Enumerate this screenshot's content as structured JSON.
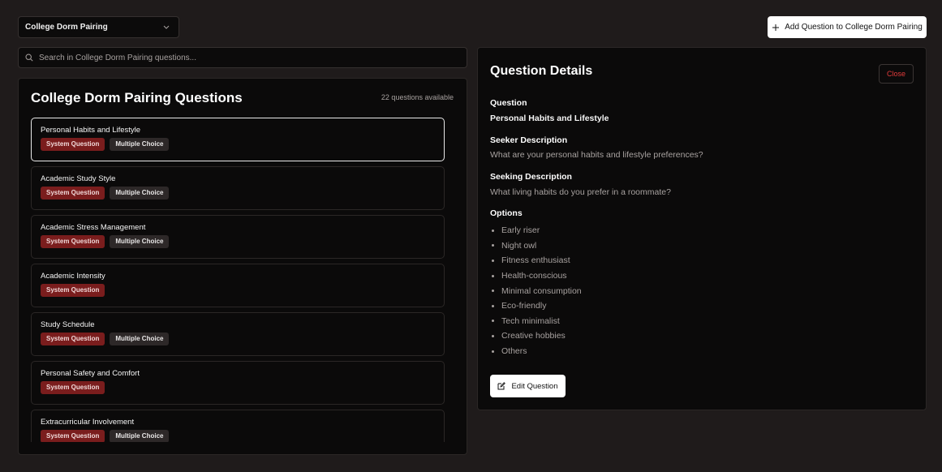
{
  "category_select": {
    "value": "College Dorm Pairing"
  },
  "add_button": {
    "label": "Add Question to College Dorm Pairing"
  },
  "search": {
    "placeholder": "Search in College Dorm Pairing questions..."
  },
  "list": {
    "title": "College Dorm Pairing Questions",
    "count": "22 questions available",
    "items": [
      {
        "title": "Personal Habits and Lifestyle",
        "tags": [
          "System Question",
          "Multiple Choice"
        ],
        "selected": true
      },
      {
        "title": "Academic Study Style",
        "tags": [
          "System Question",
          "Multiple Choice"
        ]
      },
      {
        "title": "Academic Stress Management",
        "tags": [
          "System Question",
          "Multiple Choice"
        ]
      },
      {
        "title": "Academic Intensity",
        "tags": [
          "System Question"
        ]
      },
      {
        "title": "Study Schedule",
        "tags": [
          "System Question",
          "Multiple Choice"
        ]
      },
      {
        "title": "Personal Safety and Comfort",
        "tags": [
          "System Question"
        ]
      },
      {
        "title": "Extracurricular Involvement",
        "tags": [
          "System Question",
          "Multiple Choice"
        ]
      }
    ]
  },
  "details": {
    "title": "Question Details",
    "close_label": "Close",
    "question_label": "Question",
    "question_value": "Personal Habits and Lifestyle",
    "seeker_label": "Seeker Description",
    "seeker_value": "What are your personal habits and lifestyle preferences?",
    "seeking_label": "Seeking Description",
    "seeking_value": "What living habits do you prefer in a roommate?",
    "options_label": "Options",
    "options": [
      "Early riser",
      "Night owl",
      "Fitness enthusiast",
      "Health-conscious",
      "Minimal consumption",
      "Eco-friendly",
      "Tech minimalist",
      "Creative hobbies",
      "Others"
    ],
    "edit_label": "Edit Question"
  },
  "icons": {
    "dropdown": "chevron-down-icon",
    "add": "plus-icon",
    "search": "search-icon",
    "edit": "edit-icon"
  },
  "colors": {
    "background": "#1f1b1b",
    "panel": "#0b0a0a",
    "system_tag": "#7a1d1d",
    "close_text": "#e23b3b"
  }
}
